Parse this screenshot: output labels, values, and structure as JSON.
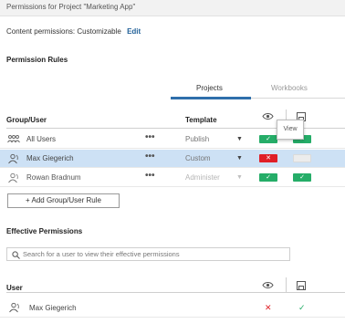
{
  "window": {
    "title": "Permissions for Project \"Marketing App\""
  },
  "content_permissions": {
    "label": "Content permissions: Customizable",
    "edit_link": "Edit"
  },
  "permission_rules": {
    "heading": "Permission Rules",
    "tabs": [
      {
        "label": "Projects",
        "active": true
      },
      {
        "label": "Workbooks",
        "active": false
      }
    ],
    "columns": {
      "group_user": "Group/User",
      "template": "Template"
    },
    "capability_icons": [
      "eye-icon",
      "save-icon"
    ],
    "tooltip": "View",
    "rows": [
      {
        "name": "All Users",
        "icon": "group-icon",
        "more": "•••",
        "template": "Publish",
        "caret": "▼",
        "selected": false,
        "capabilities": [
          "allow",
          "allow"
        ],
        "cap_marks": [
          "✓",
          "✓"
        ]
      },
      {
        "name": "Max Giegerich",
        "icon": "user-icon",
        "more": "•••",
        "template": "Custom",
        "caret": "▼",
        "selected": true,
        "capabilities": [
          "deny",
          "unset"
        ],
        "cap_marks": [
          "✕",
          ""
        ]
      },
      {
        "name": "Rowan Bradnum",
        "icon": "user-icon",
        "more": "•••",
        "template": "Administer",
        "caret": "▼",
        "selected": false,
        "capabilities": [
          "allow",
          "allow"
        ],
        "cap_marks": [
          "✓",
          "✓"
        ]
      }
    ],
    "add_button": "+ Add Group/User Rule"
  },
  "effective_permissions": {
    "heading": "Effective Permissions",
    "search_placeholder": "Search for a user to view their effective permissions",
    "search_value": "",
    "columns": {
      "user": "User"
    },
    "capability_icons": [
      "eye-icon",
      "save-icon"
    ],
    "rows": [
      {
        "name": "Max Giegerich",
        "icon": "user-icon",
        "marks": [
          "✕",
          "✓"
        ],
        "states": [
          "deny",
          "allow"
        ]
      }
    ]
  },
  "colors": {
    "accent": "#2f6fab",
    "allow": "#25ad68",
    "deny": "#e01f26",
    "selected_row": "#cde1f5",
    "link": "#1f5f97"
  }
}
